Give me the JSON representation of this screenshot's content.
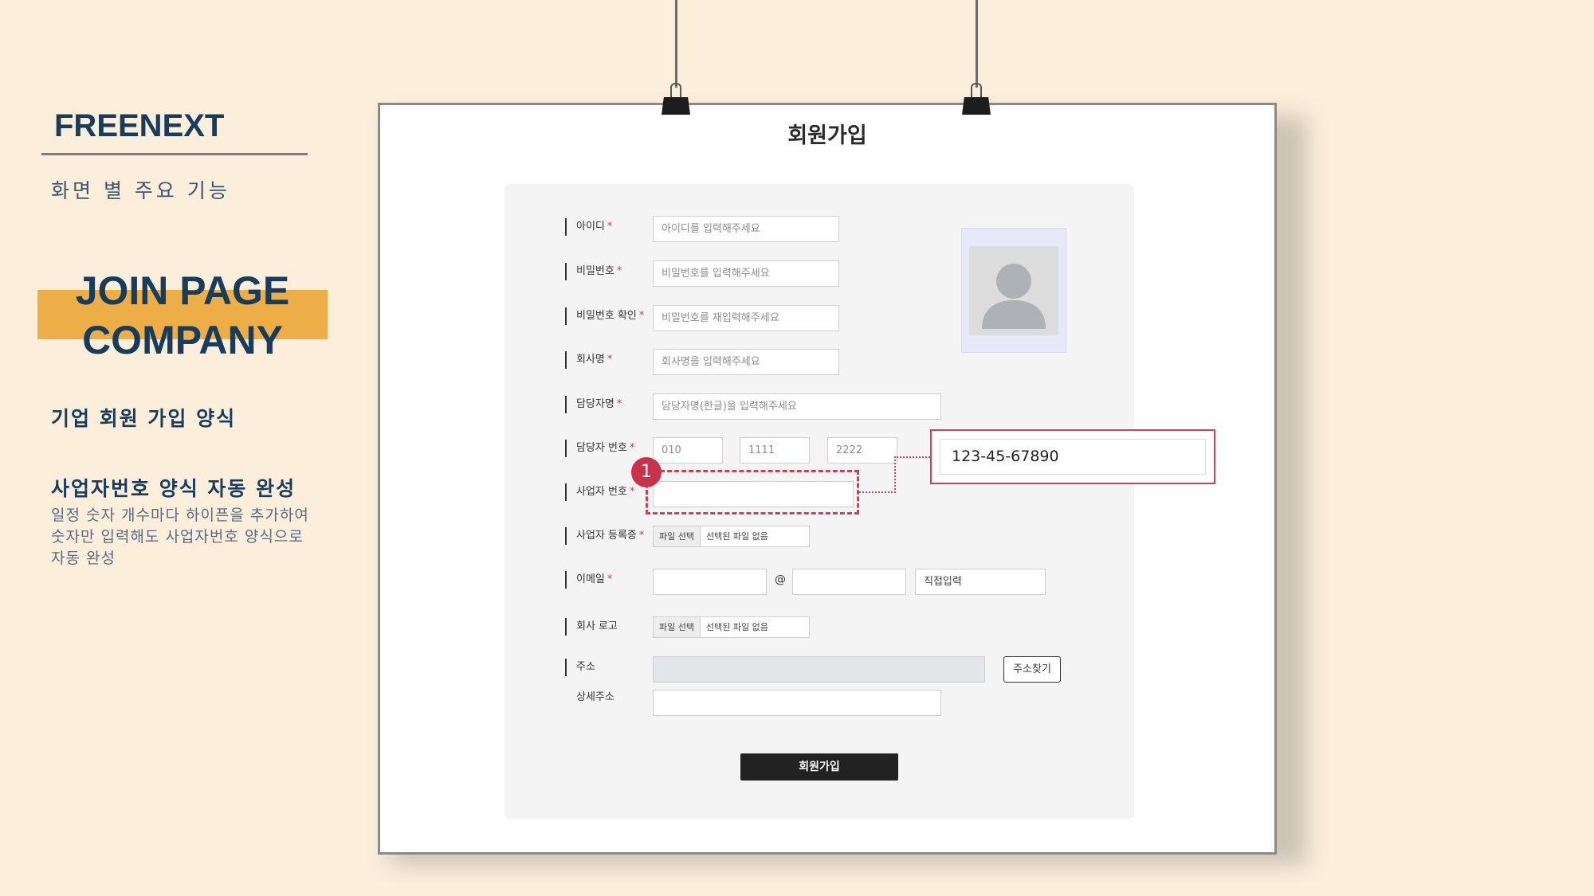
{
  "sidebar": {
    "brand": "FREENEXT",
    "subtitle": "화면 별 주요 기능",
    "page_title_line1": "JOIN PAGE",
    "page_title_line2": "COMPANY",
    "section1_title": "기업 회원 가입 양식",
    "section2_title": "사업자번호 양식 자동 완성",
    "section2_desc_lines": [
      "일정 숫자 개수마다 하이픈을 추가하여",
      "숫자만 입력해도 사업자번호 양식으로",
      "자동 완성"
    ]
  },
  "form": {
    "heading": "회원가입",
    "required_mark": "*",
    "fields": {
      "id": {
        "label": "아이디",
        "placeholder": "아이디를 입력해주세요"
      },
      "password": {
        "label": "비밀번호",
        "placeholder": "비밀번호를 입력해주세요"
      },
      "password_confirm": {
        "label": "비밀번호 확인",
        "placeholder": "비밀번호를 재입력해주세요"
      },
      "company_name": {
        "label": "회사명",
        "placeholder": "회사명을 입력해주세요"
      },
      "manager_name": {
        "label": "담당자명",
        "placeholder": "담당자명(한글)을 입력해주세요"
      },
      "manager_phone": {
        "label": "담당자 번호",
        "part1": "010",
        "part2": "1111",
        "part3": "2222"
      },
      "business_number": {
        "label": "사업자 번호",
        "value": ""
      },
      "business_cert": {
        "label": "사업자 등록증",
        "file_button": "파일 선택",
        "file_name": "선택된 파일 없음"
      },
      "email": {
        "label": "이메일",
        "at": "@",
        "domain_select": "직접입력"
      },
      "company_logo": {
        "label": "회사 로고",
        "file_button": "파일 선택",
        "file_name": "선택된 파일 없음"
      },
      "address": {
        "label": "주소",
        "search_button": "주소찾기"
      },
      "address_detail": {
        "label": "상세주소"
      }
    },
    "submit_label": "회원가입"
  },
  "annotation": {
    "marker_number": "1",
    "callout_value": "123-45-67890",
    "highlight_color": "#c9445a"
  },
  "colors": {
    "background": "#fbeedb",
    "accent": "#eeae47",
    "brand": "#173c5c"
  }
}
